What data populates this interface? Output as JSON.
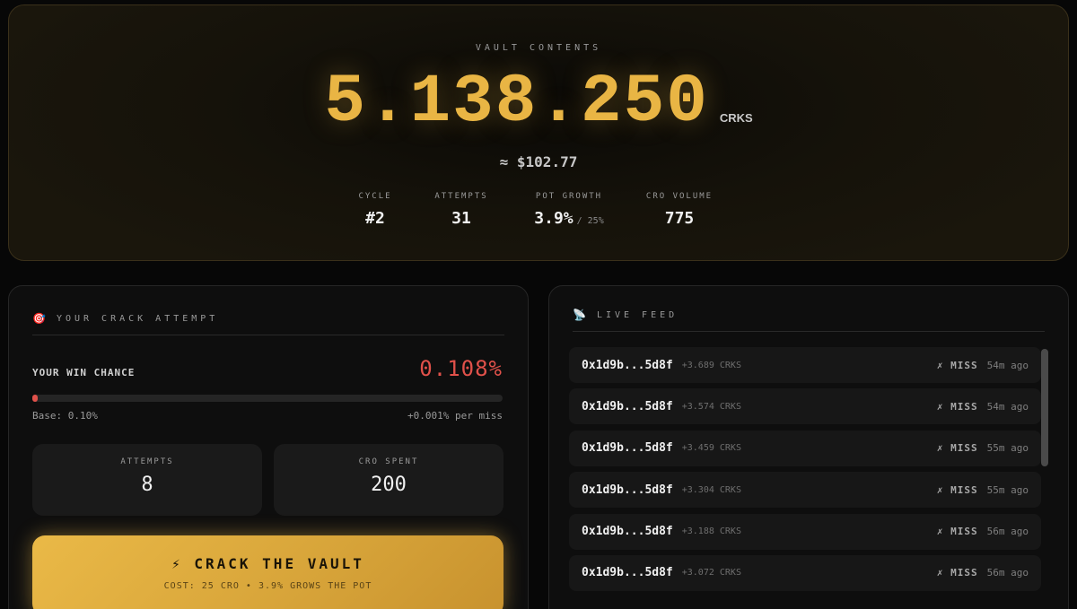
{
  "vault": {
    "label": "VAULT CONTENTS",
    "amount": "5.138.250",
    "unit": "CRKS",
    "usd": "≈ $102.77",
    "stats": {
      "cycle": {
        "label": "CYCLE",
        "value": "#2"
      },
      "attempts": {
        "label": "ATTEMPTS",
        "value": "31"
      },
      "pot_growth": {
        "label": "POT GROWTH",
        "value": "3.9%",
        "sub": "/ 25%"
      },
      "cro_volume": {
        "label": "CRO VOLUME",
        "value": "775"
      }
    }
  },
  "crack": {
    "icon": "🎯",
    "title": "YOUR CRACK ATTEMPT",
    "win_label": "YOUR WIN CHANCE",
    "win_value": "0.108%",
    "win_fraction": 0.00108,
    "base_label": "Base: 0.10%",
    "miss_label": "+0.001% per miss",
    "attempts_label": "ATTEMPTS",
    "attempts_value": "8",
    "spent_label": "CRO SPENT",
    "spent_value": "200",
    "button_label": "⚡ CRACK THE VAULT",
    "button_sub": "COST: 25 CRO • 3.9% GROWS THE POT"
  },
  "feed": {
    "icon": "📡",
    "title": "LIVE FEED",
    "rows": [
      {
        "address": "0x1d9b...5d8f",
        "amount": "+3.689 CRKS",
        "result": "✗ MISS",
        "time": "54m ago"
      },
      {
        "address": "0x1d9b...5d8f",
        "amount": "+3.574 CRKS",
        "result": "✗ MISS",
        "time": "54m ago"
      },
      {
        "address": "0x1d9b...5d8f",
        "amount": "+3.459 CRKS",
        "result": "✗ MISS",
        "time": "55m ago"
      },
      {
        "address": "0x1d9b...5d8f",
        "amount": "+3.304 CRKS",
        "result": "✗ MISS",
        "time": "55m ago"
      },
      {
        "address": "0x1d9b...5d8f",
        "amount": "+3.188 CRKS",
        "result": "✗ MISS",
        "time": "56m ago"
      },
      {
        "address": "0x1d9b...5d8f",
        "amount": "+3.072 CRKS",
        "result": "✗ MISS",
        "time": "56m ago"
      }
    ]
  },
  "colors": {
    "gold": "#e9b544",
    "red": "#e0514a",
    "background": "#070707"
  }
}
